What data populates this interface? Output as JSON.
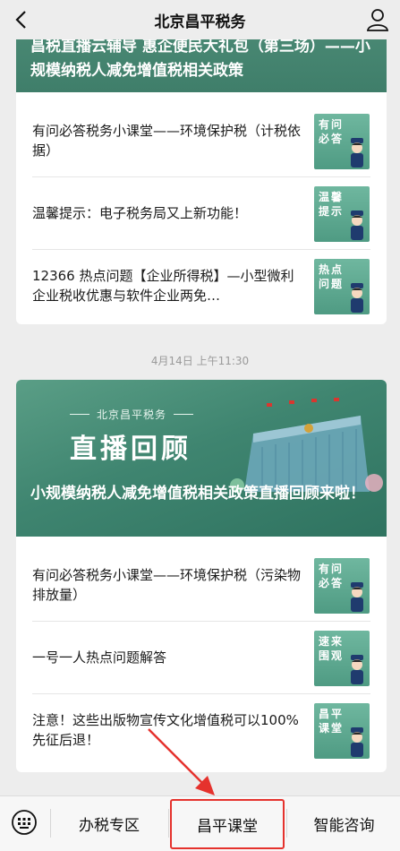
{
  "header": {
    "title": "北京昌平税务"
  },
  "card1": {
    "banner_title": "昌税直播云辅导 惠企便民大礼包（第三场）——小规模纳税人减免增值税相关政策",
    "items": [
      {
        "text": "有问必答税务小课堂——环境保护税（计税依据）",
        "thumb": "有问必答"
      },
      {
        "text": "温馨提示：电子税务局又上新功能！",
        "thumb": "温馨提示"
      },
      {
        "text": "12366 热点问题【企业所得税】—小型微利企业税收优惠与软件企业两免…",
        "thumb": "热点问题"
      }
    ]
  },
  "timestamp": "4月14日 上午11:30",
  "card2": {
    "brand": "北京昌平税务",
    "banner_big": "直播回顾",
    "banner_title": "小规模纳税人减免增值税相关政策直播回顾来啦！",
    "items": [
      {
        "text": "有问必答税务小课堂——环境保护税（污染物排放量）",
        "thumb": "有问必答"
      },
      {
        "text": "一号一人热点问题解答",
        "thumb": "速来围观"
      },
      {
        "text": "注意！这些出版物宣传文化增值税可以100% 先征后退！",
        "thumb": "昌平课堂"
      }
    ]
  },
  "bottom_menu": {
    "tabs": [
      "办税专区",
      "昌平课堂",
      "智能咨询"
    ]
  },
  "colors": {
    "accent_green": "#4f9b83",
    "highlight_red": "#e5322d"
  }
}
